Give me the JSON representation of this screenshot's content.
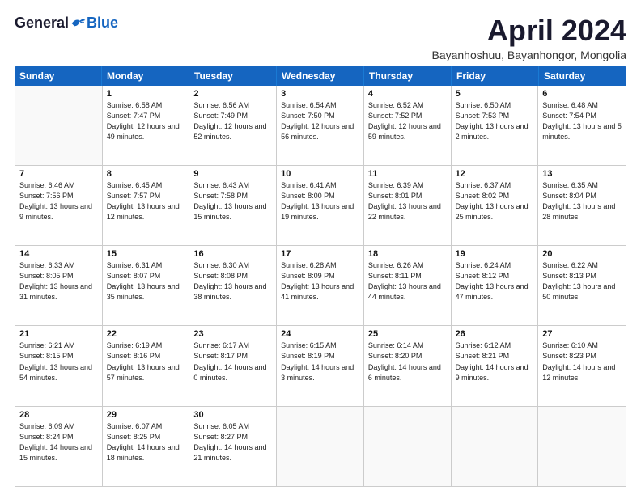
{
  "header": {
    "logo": {
      "general": "General",
      "blue": "Blue"
    },
    "title": "April 2024",
    "location": "Bayanhoshuu, Bayanhongor, Mongolia"
  },
  "weekdays": [
    "Sunday",
    "Monday",
    "Tuesday",
    "Wednesday",
    "Thursday",
    "Friday",
    "Saturday"
  ],
  "weeks": [
    [
      {
        "day": "",
        "sunrise": "",
        "sunset": "",
        "daylight": ""
      },
      {
        "day": "1",
        "sunrise": "Sunrise: 6:58 AM",
        "sunset": "Sunset: 7:47 PM",
        "daylight": "Daylight: 12 hours and 49 minutes."
      },
      {
        "day": "2",
        "sunrise": "Sunrise: 6:56 AM",
        "sunset": "Sunset: 7:49 PM",
        "daylight": "Daylight: 12 hours and 52 minutes."
      },
      {
        "day": "3",
        "sunrise": "Sunrise: 6:54 AM",
        "sunset": "Sunset: 7:50 PM",
        "daylight": "Daylight: 12 hours and 56 minutes."
      },
      {
        "day": "4",
        "sunrise": "Sunrise: 6:52 AM",
        "sunset": "Sunset: 7:52 PM",
        "daylight": "Daylight: 12 hours and 59 minutes."
      },
      {
        "day": "5",
        "sunrise": "Sunrise: 6:50 AM",
        "sunset": "Sunset: 7:53 PM",
        "daylight": "Daylight: 13 hours and 2 minutes."
      },
      {
        "day": "6",
        "sunrise": "Sunrise: 6:48 AM",
        "sunset": "Sunset: 7:54 PM",
        "daylight": "Daylight: 13 hours and 5 minutes."
      }
    ],
    [
      {
        "day": "7",
        "sunrise": "Sunrise: 6:46 AM",
        "sunset": "Sunset: 7:56 PM",
        "daylight": "Daylight: 13 hours and 9 minutes."
      },
      {
        "day": "8",
        "sunrise": "Sunrise: 6:45 AM",
        "sunset": "Sunset: 7:57 PM",
        "daylight": "Daylight: 13 hours and 12 minutes."
      },
      {
        "day": "9",
        "sunrise": "Sunrise: 6:43 AM",
        "sunset": "Sunset: 7:58 PM",
        "daylight": "Daylight: 13 hours and 15 minutes."
      },
      {
        "day": "10",
        "sunrise": "Sunrise: 6:41 AM",
        "sunset": "Sunset: 8:00 PM",
        "daylight": "Daylight: 13 hours and 19 minutes."
      },
      {
        "day": "11",
        "sunrise": "Sunrise: 6:39 AM",
        "sunset": "Sunset: 8:01 PM",
        "daylight": "Daylight: 13 hours and 22 minutes."
      },
      {
        "day": "12",
        "sunrise": "Sunrise: 6:37 AM",
        "sunset": "Sunset: 8:02 PM",
        "daylight": "Daylight: 13 hours and 25 minutes."
      },
      {
        "day": "13",
        "sunrise": "Sunrise: 6:35 AM",
        "sunset": "Sunset: 8:04 PM",
        "daylight": "Daylight: 13 hours and 28 minutes."
      }
    ],
    [
      {
        "day": "14",
        "sunrise": "Sunrise: 6:33 AM",
        "sunset": "Sunset: 8:05 PM",
        "daylight": "Daylight: 13 hours and 31 minutes."
      },
      {
        "day": "15",
        "sunrise": "Sunrise: 6:31 AM",
        "sunset": "Sunset: 8:07 PM",
        "daylight": "Daylight: 13 hours and 35 minutes."
      },
      {
        "day": "16",
        "sunrise": "Sunrise: 6:30 AM",
        "sunset": "Sunset: 8:08 PM",
        "daylight": "Daylight: 13 hours and 38 minutes."
      },
      {
        "day": "17",
        "sunrise": "Sunrise: 6:28 AM",
        "sunset": "Sunset: 8:09 PM",
        "daylight": "Daylight: 13 hours and 41 minutes."
      },
      {
        "day": "18",
        "sunrise": "Sunrise: 6:26 AM",
        "sunset": "Sunset: 8:11 PM",
        "daylight": "Daylight: 13 hours and 44 minutes."
      },
      {
        "day": "19",
        "sunrise": "Sunrise: 6:24 AM",
        "sunset": "Sunset: 8:12 PM",
        "daylight": "Daylight: 13 hours and 47 minutes."
      },
      {
        "day": "20",
        "sunrise": "Sunrise: 6:22 AM",
        "sunset": "Sunset: 8:13 PM",
        "daylight": "Daylight: 13 hours and 50 minutes."
      }
    ],
    [
      {
        "day": "21",
        "sunrise": "Sunrise: 6:21 AM",
        "sunset": "Sunset: 8:15 PM",
        "daylight": "Daylight: 13 hours and 54 minutes."
      },
      {
        "day": "22",
        "sunrise": "Sunrise: 6:19 AM",
        "sunset": "Sunset: 8:16 PM",
        "daylight": "Daylight: 13 hours and 57 minutes."
      },
      {
        "day": "23",
        "sunrise": "Sunrise: 6:17 AM",
        "sunset": "Sunset: 8:17 PM",
        "daylight": "Daylight: 14 hours and 0 minutes."
      },
      {
        "day": "24",
        "sunrise": "Sunrise: 6:15 AM",
        "sunset": "Sunset: 8:19 PM",
        "daylight": "Daylight: 14 hours and 3 minutes."
      },
      {
        "day": "25",
        "sunrise": "Sunrise: 6:14 AM",
        "sunset": "Sunset: 8:20 PM",
        "daylight": "Daylight: 14 hours and 6 minutes."
      },
      {
        "day": "26",
        "sunrise": "Sunrise: 6:12 AM",
        "sunset": "Sunset: 8:21 PM",
        "daylight": "Daylight: 14 hours and 9 minutes."
      },
      {
        "day": "27",
        "sunrise": "Sunrise: 6:10 AM",
        "sunset": "Sunset: 8:23 PM",
        "daylight": "Daylight: 14 hours and 12 minutes."
      }
    ],
    [
      {
        "day": "28",
        "sunrise": "Sunrise: 6:09 AM",
        "sunset": "Sunset: 8:24 PM",
        "daylight": "Daylight: 14 hours and 15 minutes."
      },
      {
        "day": "29",
        "sunrise": "Sunrise: 6:07 AM",
        "sunset": "Sunset: 8:25 PM",
        "daylight": "Daylight: 14 hours and 18 minutes."
      },
      {
        "day": "30",
        "sunrise": "Sunrise: 6:05 AM",
        "sunset": "Sunset: 8:27 PM",
        "daylight": "Daylight: 14 hours and 21 minutes."
      },
      {
        "day": "",
        "sunrise": "",
        "sunset": "",
        "daylight": ""
      },
      {
        "day": "",
        "sunrise": "",
        "sunset": "",
        "daylight": ""
      },
      {
        "day": "",
        "sunrise": "",
        "sunset": "",
        "daylight": ""
      },
      {
        "day": "",
        "sunrise": "",
        "sunset": "",
        "daylight": ""
      }
    ]
  ]
}
